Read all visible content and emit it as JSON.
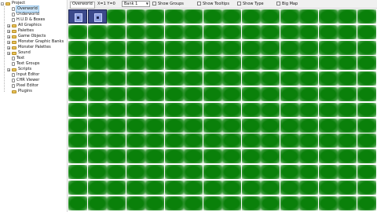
{
  "tree": {
    "items": [
      {
        "label": "Project",
        "level": 0,
        "toggle": "-",
        "icon": "folder-icon"
      },
      {
        "label": "Overworld",
        "level": 1,
        "toggle": "",
        "icon": "document-icon",
        "selected": true
      },
      {
        "label": "Underworld",
        "level": 1,
        "toggle": "",
        "icon": "document-icon"
      },
      {
        "label": "H.U.D & Boxes",
        "level": 1,
        "toggle": "",
        "icon": "document-icon"
      },
      {
        "label": "All Graphics",
        "level": 1,
        "toggle": "+",
        "icon": "folder-icon"
      },
      {
        "label": "Palettes",
        "level": 1,
        "toggle": "+",
        "icon": "folder-icon"
      },
      {
        "label": "Game Objects",
        "level": 1,
        "toggle": "+",
        "icon": "folder-icon"
      },
      {
        "label": "Monster Graphic Banks",
        "level": 1,
        "toggle": "+",
        "icon": "folder-icon"
      },
      {
        "label": "Monster Palettes",
        "level": 1,
        "toggle": "+",
        "icon": "folder-icon"
      },
      {
        "label": "Sound",
        "level": 1,
        "toggle": "+",
        "icon": "folder-icon"
      },
      {
        "label": "Text",
        "level": 1,
        "toggle": "",
        "icon": "document-icon"
      },
      {
        "label": "Text Groups",
        "level": 1,
        "toggle": "",
        "icon": "document-icon"
      },
      {
        "label": "Scripts",
        "level": 1,
        "toggle": "+",
        "icon": "folder-icon"
      },
      {
        "label": "Input Editor",
        "level": 1,
        "toggle": "",
        "icon": "document-icon"
      },
      {
        "label": "CHR Viewer",
        "level": 1,
        "toggle": "",
        "icon": "document-icon"
      },
      {
        "label": "Pixel Editor",
        "level": 1,
        "toggle": "",
        "icon": "document-icon"
      },
      {
        "label": "Plugins",
        "level": 1,
        "toggle": "",
        "icon": "folder-icon"
      }
    ]
  },
  "toolbar": {
    "tab_label": "Overworld",
    "coords": "X=1 Y=0",
    "bank_select": "Bank 1",
    "show_groups": "Show Groups",
    "show_tooltips": "Show Tooltips",
    "show_type": "Show Type",
    "big_map": "Big Map"
  },
  "map": {
    "columns": 16,
    "rows": 13,
    "tile_icon": "grass-tile",
    "special_tiles": [
      {
        "col": 0,
        "row": 0,
        "icon": "door-tile"
      },
      {
        "col": 1,
        "row": 0,
        "icon": "door-tile"
      }
    ],
    "colors": {
      "grass": "#0a800a",
      "door": "#3c4a8c"
    }
  }
}
